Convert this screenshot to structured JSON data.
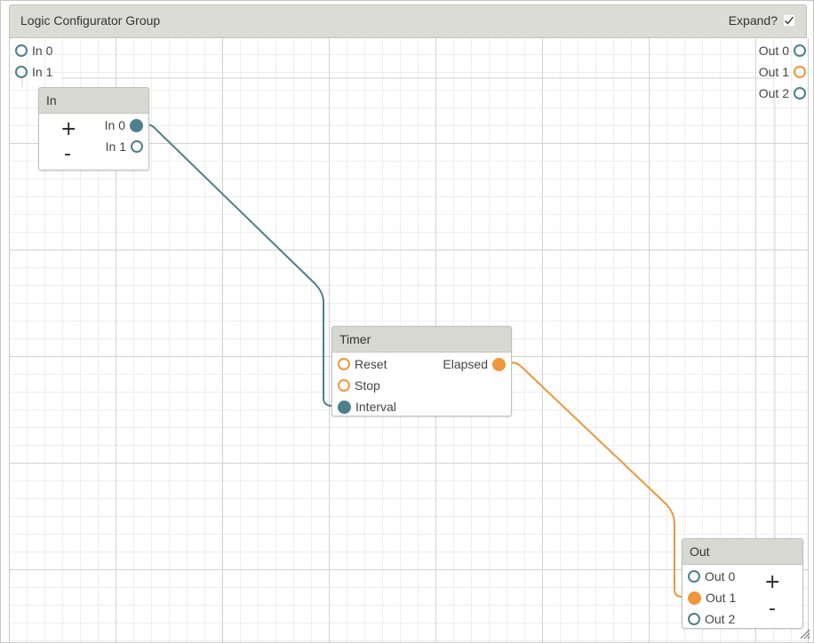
{
  "group": {
    "title": "Logic Configurator Group",
    "expand_label": "Expand?",
    "expand_checked": true
  },
  "group_inputs": [
    "In 0",
    "In 1"
  ],
  "group_outputs": [
    "Out 0",
    "Out 1",
    "Out 2"
  ],
  "nodes": {
    "in": {
      "title": "In",
      "plus": "+",
      "minus": "-",
      "ports": [
        "In 0",
        "In 1"
      ]
    },
    "timer": {
      "title": "Timer",
      "inputs": [
        "Reset",
        "Stop",
        "Interval"
      ],
      "outputs": [
        "Elapsed"
      ]
    },
    "out": {
      "title": "Out",
      "plus": "+",
      "minus": "-",
      "ports": [
        "Out 0",
        "Out 1",
        "Out 2"
      ]
    }
  },
  "colors": {
    "teal": "#4e7f8c",
    "orange": "#f0963c",
    "header": "#d8d8d2",
    "grid_major": "#d2d2d2",
    "grid_minor": "#eeeeee"
  },
  "icons": {
    "expand_check": "check-icon",
    "resize": "resize-grip-icon"
  }
}
